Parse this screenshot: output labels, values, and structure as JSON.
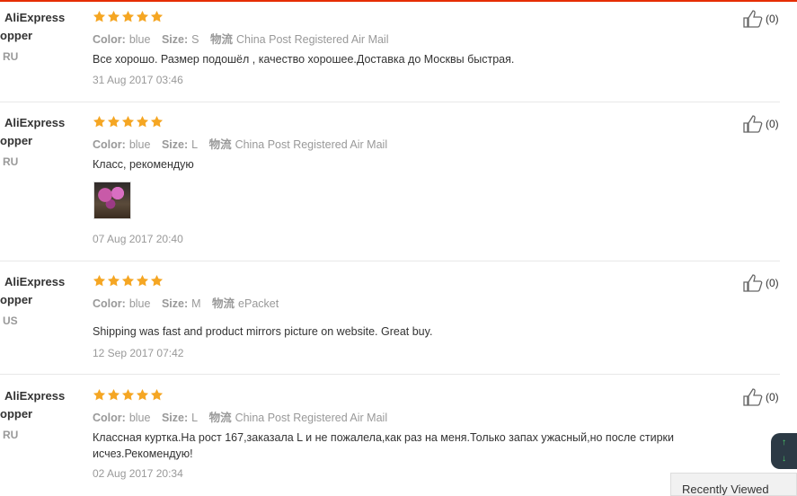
{
  "colors": {
    "topbar": "#e62e04",
    "star": "#f5a623",
    "muted": "#999999",
    "text": "#333333"
  },
  "reviews": [
    {
      "user_line1": "AliExpress",
      "user_line2": "opper",
      "country": "RU",
      "rating": 5,
      "color_label": "Color:",
      "color": "blue",
      "size_label": "Size:",
      "size": "S",
      "shipping_label": "物流",
      "shipping": "China Post Registered Air Mail",
      "text": "Все хорошо. Размер подошёл , качество хорошее.Доставка до Москвы быстрая.",
      "date": "31 Aug 2017 03:46",
      "helpful": "(0)",
      "has_photo": false
    },
    {
      "user_line1": "AliExpress",
      "user_line2": "opper",
      "country": "RU",
      "rating": 5,
      "color_label": "Color:",
      "color": "blue",
      "size_label": "Size:",
      "size": "L",
      "shipping_label": "物流",
      "shipping": "China Post Registered Air Mail",
      "text": "Класс, рекомендую",
      "date": "07 Aug 2017 20:40",
      "helpful": "(0)",
      "has_photo": true
    },
    {
      "user_line1": "AliExpress",
      "user_line2": "opper",
      "country": "US",
      "rating": 5,
      "color_label": "Color:",
      "color": "blue",
      "size_label": "Size:",
      "size": "M",
      "shipping_label": "物流",
      "shipping": "ePacket",
      "text": "Shipping was fast and product mirrors picture on website. Great buy.",
      "date": "12 Sep 2017 07:42",
      "helpful": "(0)",
      "has_photo": false
    },
    {
      "user_line1": "AliExpress",
      "user_line2": "opper",
      "country": "RU",
      "rating": 5,
      "color_label": "Color:",
      "color": "blue",
      "size_label": "Size:",
      "size": "L",
      "shipping_label": "物流",
      "shipping": "China Post Registered Air Mail",
      "text": "Классная куртка.На рост 167,заказала L и не пожалела,как раз на меня.Только запах ужасный,но после стирки исчез.Рекомендую!",
      "date": "02 Aug 2017 20:34",
      "helpful": "(0)",
      "has_photo": false
    }
  ],
  "scroll_widget": {
    "up_icon": "arrow-up-icon",
    "down_icon": "arrow-down-icon"
  },
  "recently_viewed": "Recently Viewed"
}
